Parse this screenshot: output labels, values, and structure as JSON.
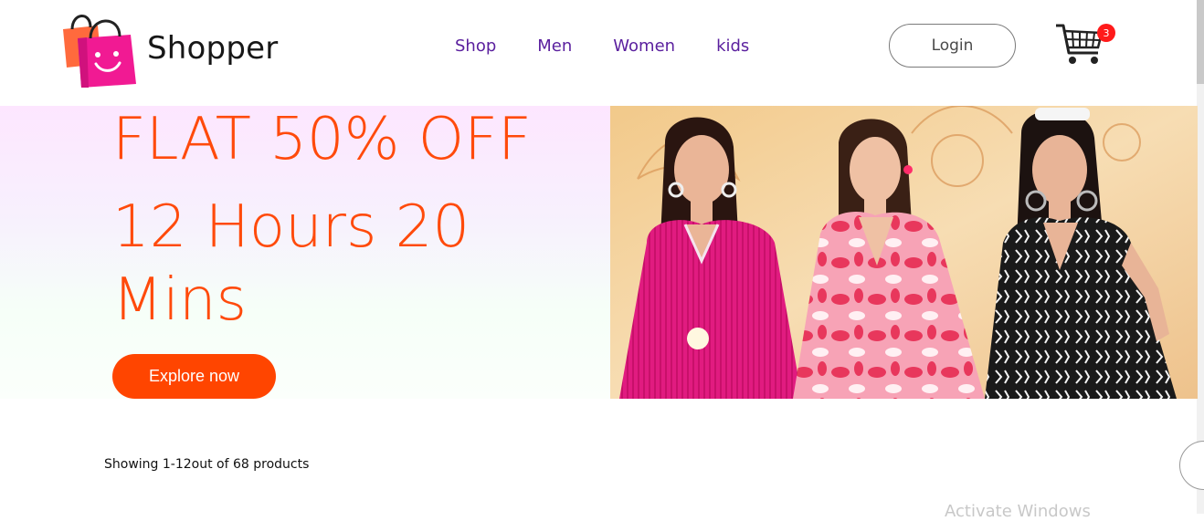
{
  "brand": {
    "name": "Shopper"
  },
  "nav": {
    "items": [
      "Shop",
      "Men",
      "Women",
      "kids"
    ]
  },
  "header": {
    "login_label": "Login",
    "cart_count": "3"
  },
  "hero": {
    "line1": "FLAT 50% OFF",
    "line2": "12 Hours 20",
    "line3": "Mins",
    "cta_label": "Explore now"
  },
  "products": {
    "showing_text": "Showing 1-12out of 68 products"
  },
  "system": {
    "watermark": "Activate Windows"
  },
  "colors": {
    "accent": "#ff4500",
    "nav_text": "#5a1f9e",
    "badge": "#ff1a1a"
  }
}
